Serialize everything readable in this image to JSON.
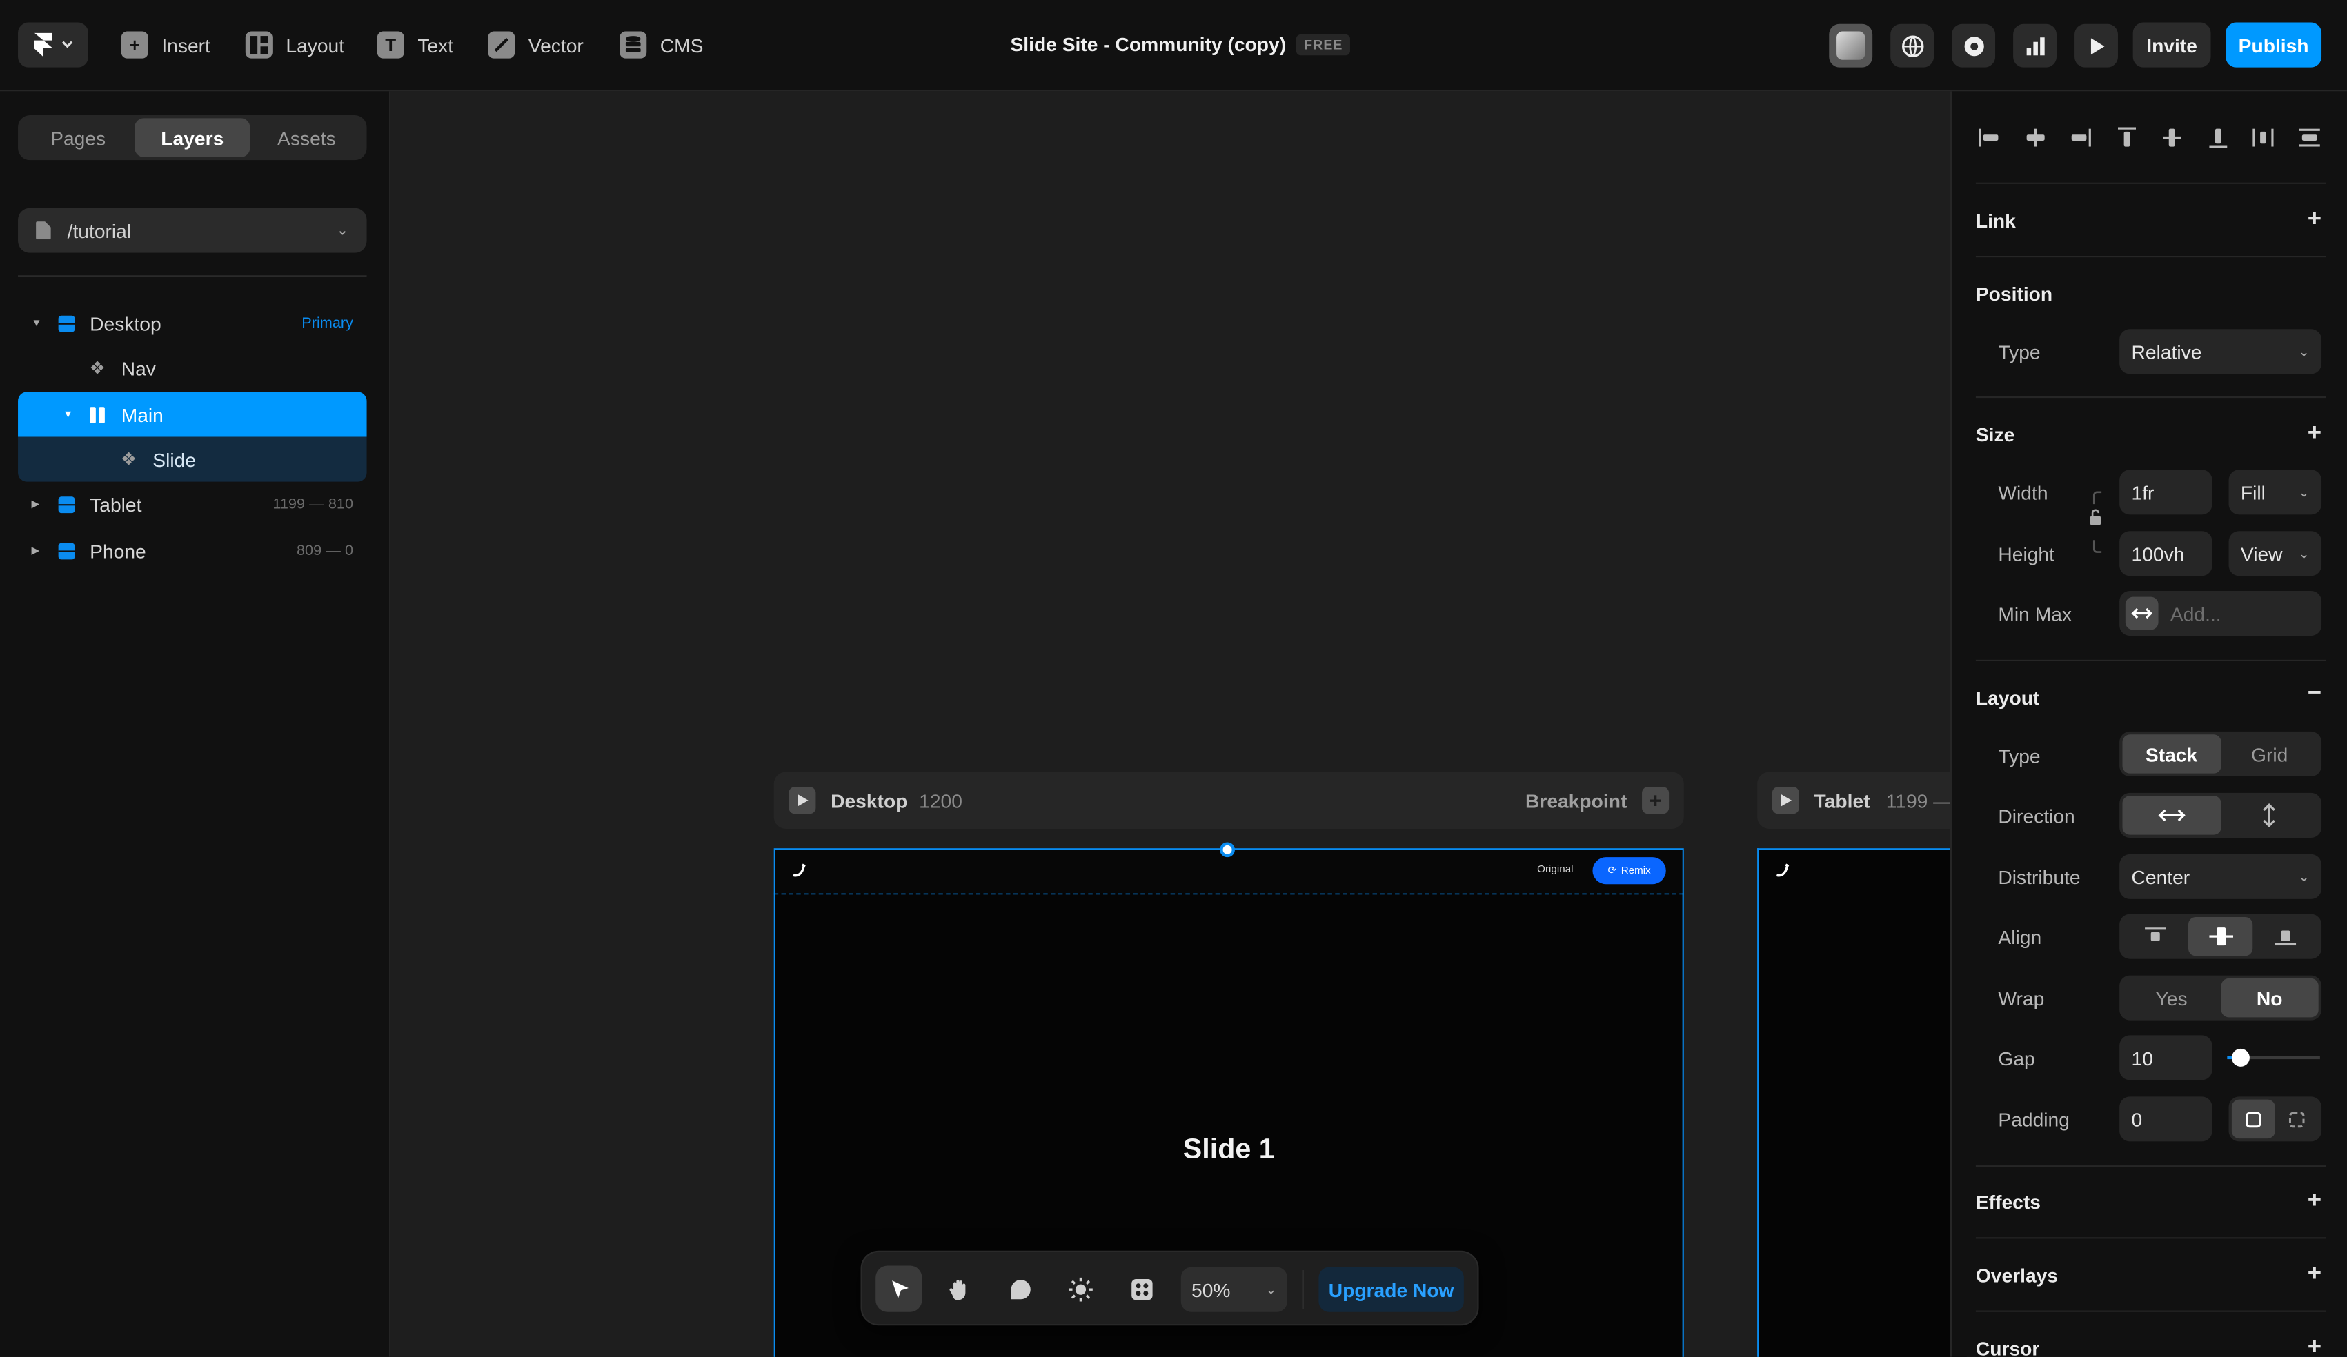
{
  "topbar": {
    "tools": [
      {
        "label": "Insert",
        "icon": "plus-icon"
      },
      {
        "label": "Layout",
        "icon": "layout-icon"
      },
      {
        "label": "Text",
        "icon": "text-icon"
      },
      {
        "label": "Vector",
        "icon": "pen-icon"
      },
      {
        "label": "CMS",
        "icon": "database-icon"
      }
    ],
    "doc_title": "Slide Site - Community (copy)",
    "plan_badge": "FREE",
    "invite_label": "Invite",
    "publish_label": "Publish",
    "accent": "#0099ff"
  },
  "left": {
    "tabs": [
      "Pages",
      "Layers",
      "Assets"
    ],
    "active_tab": "Layers",
    "page_path": "/tutorial",
    "layers": [
      {
        "name": "Desktop",
        "meta": "Primary"
      },
      {
        "name": "Nav"
      },
      {
        "name": "Main"
      },
      {
        "name": "Slide"
      },
      {
        "name": "Tablet",
        "meta": "1199 — 810"
      },
      {
        "name": "Phone",
        "meta": "809 — 0"
      }
    ]
  },
  "canvas": {
    "desktop": {
      "name": "Desktop",
      "width": "1200",
      "breakpoint_label": "Breakpoint"
    },
    "tablet": {
      "name": "Tablet",
      "width": "1199 —"
    },
    "nav_original": "Original",
    "nav_remix": "Remix",
    "slide_title": "Slide 1",
    "toolbar": {
      "zoom": "50%",
      "upgrade": "Upgrade Now"
    }
  },
  "right": {
    "link": "Link",
    "position": {
      "title": "Position",
      "type_label": "Type",
      "type_value": "Relative"
    },
    "size": {
      "title": "Size",
      "width_label": "Width",
      "width_value": "1fr",
      "width_mode": "Fill",
      "height_label": "Height",
      "height_value": "100vh",
      "height_mode": "View",
      "minmax_label": "Min Max",
      "minmax_placeholder": "Add..."
    },
    "layout": {
      "title": "Layout",
      "type_label": "Type",
      "type_options": [
        "Stack",
        "Grid"
      ],
      "direction_label": "Direction",
      "distribute_label": "Distribute",
      "distribute_value": "Center",
      "align_label": "Align",
      "wrap_label": "Wrap",
      "wrap_options": [
        "Yes",
        "No"
      ],
      "gap_label": "Gap",
      "gap_value": "10",
      "gap_level": 0.15,
      "padding_label": "Padding",
      "padding_value": "0"
    },
    "effects": "Effects",
    "overlays": "Overlays",
    "cursor": "Cursor"
  }
}
